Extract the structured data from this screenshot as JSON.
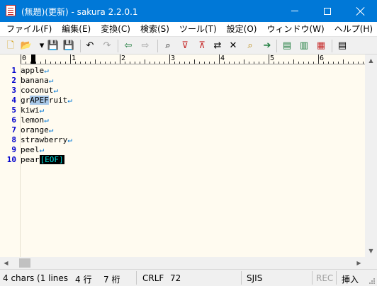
{
  "window": {
    "title": "(無題)(更新) - sakura 2.2.0.1",
    "minimize_glyph": "minimize",
    "maximize_glyph": "maximize",
    "close_glyph": "close"
  },
  "menu": {
    "items": [
      {
        "label": "ファイル(F)"
      },
      {
        "label": "編集(E)"
      },
      {
        "label": "変換(C)"
      },
      {
        "label": "検索(S)"
      },
      {
        "label": "ツール(T)"
      },
      {
        "label": "設定(O)"
      },
      {
        "label": "ウィンドウ(W)"
      },
      {
        "label": "ヘルプ(H)"
      }
    ]
  },
  "toolbar": {
    "icons": [
      {
        "name": "new-file-icon",
        "glyph": "🗋",
        "color": "#d4a017"
      },
      {
        "name": "open-folder-icon",
        "glyph": "📂",
        "color": "#d4a017"
      },
      {
        "name": "open-dropdown-icon",
        "glyph": "▾",
        "color": "#000000"
      },
      {
        "name": "save-icon",
        "glyph": "💾",
        "color": "#1a7a3a"
      },
      {
        "name": "save-as-icon",
        "glyph": "💾",
        "color": "#7a1a7a"
      },
      {
        "name": "undo-icon",
        "glyph": "↶",
        "color": "#000000"
      },
      {
        "name": "redo-icon",
        "glyph": "↷",
        "color": "#a0a0a0"
      },
      {
        "name": "jump-back-icon",
        "glyph": "⇦",
        "color": "#1a7a3a"
      },
      {
        "name": "jump-forward-icon",
        "glyph": "⇨",
        "color": "#a0a0a0"
      },
      {
        "name": "search-icon",
        "glyph": "⌕",
        "color": "#000000"
      },
      {
        "name": "search-prev-icon",
        "glyph": "⊽",
        "color": "#c62828"
      },
      {
        "name": "search-next-icon",
        "glyph": "⊼",
        "color": "#c62828"
      },
      {
        "name": "replace-icon",
        "glyph": "⇄",
        "color": "#000000"
      },
      {
        "name": "clear-search-icon",
        "glyph": "✕",
        "color": "#000000"
      },
      {
        "name": "grep-icon",
        "glyph": "⌕",
        "color": "#b8860b"
      },
      {
        "name": "bookmark-icon",
        "glyph": "➔",
        "color": "#1a7a3a"
      },
      {
        "name": "outline-icon",
        "glyph": "▤",
        "color": "#1a7a3a"
      },
      {
        "name": "compare-icon",
        "glyph": "▥",
        "color": "#1a7a3a"
      },
      {
        "name": "tag-jump-icon",
        "glyph": "▦",
        "color": "#c62828"
      },
      {
        "name": "settings-icon",
        "glyph": "▤",
        "color": "#000000"
      }
    ]
  },
  "ruler": {
    "labels": [
      "0",
      "1",
      "2",
      "3",
      "4",
      "5",
      "6"
    ]
  },
  "editor": {
    "lines": [
      {
        "num": "1",
        "text": "apple",
        "newline": "↵"
      },
      {
        "num": "2",
        "text": "banana",
        "newline": "↵"
      },
      {
        "num": "3",
        "text": "coconut",
        "newline": "↵"
      },
      {
        "num": "4",
        "text_before": "gr",
        "text_selected": "APEF",
        "text_after": "ruit",
        "newline": "↵"
      },
      {
        "num": "5",
        "text": "kiwi",
        "newline": "↵"
      },
      {
        "num": "6",
        "text": "lemon",
        "newline": "↵"
      },
      {
        "num": "7",
        "text": "orange",
        "newline": "↵"
      },
      {
        "num": "8",
        "text": "strawberry",
        "newline": "↵"
      },
      {
        "num": "9",
        "text": "peel",
        "newline": "↵"
      },
      {
        "num": "10",
        "text": "pear",
        "eof": "[EOF]"
      }
    ]
  },
  "statusbar": {
    "selection": "4 chars (1 lines",
    "row": "4 行",
    "col": "7 桁",
    "line_ending": "CRLF",
    "char_code": "72",
    "encoding": "SJIS",
    "rec": "REC",
    "mode": "挿入"
  },
  "colors": {
    "titlebar": "#0078d7",
    "editor_bg": "#fffbf0",
    "line_number": "#0000cc",
    "selection": "#a8c8e8",
    "eof_bg": "#000000",
    "eof_fg": "#00e0e0"
  }
}
